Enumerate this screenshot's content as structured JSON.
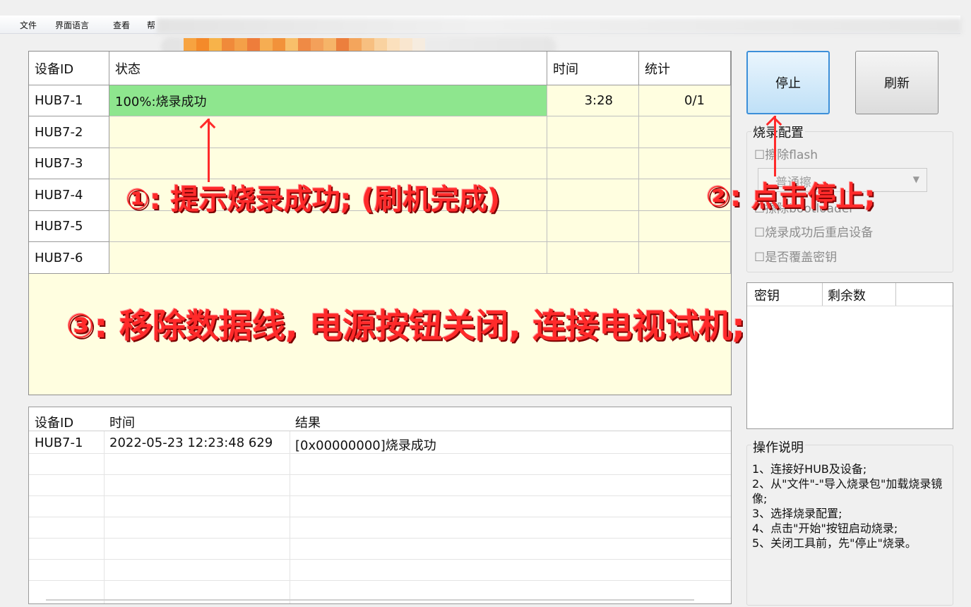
{
  "menu": {
    "file": "文件",
    "language": "界面语言",
    "view": "查看",
    "help_partial": "帮"
  },
  "grid": {
    "headers": {
      "id": "设备ID",
      "status": "状态",
      "time": "时间",
      "stats": "统计"
    },
    "rows": [
      {
        "id": "HUB7-1",
        "status": "100%:烧录成功",
        "time": "3:28",
        "stats": "0/1"
      },
      {
        "id": "HUB7-2",
        "status": "",
        "time": "",
        "stats": ""
      },
      {
        "id": "HUB7-3",
        "status": "",
        "time": "",
        "stats": ""
      },
      {
        "id": "HUB7-4",
        "status": "",
        "time": "",
        "stats": ""
      },
      {
        "id": "HUB7-5",
        "status": "",
        "time": "",
        "stats": ""
      },
      {
        "id": "HUB7-6",
        "status": "",
        "time": "",
        "stats": ""
      }
    ]
  },
  "log": {
    "headers": {
      "id": "设备ID",
      "time": "时间",
      "result": "结果"
    },
    "rows": [
      {
        "id": "HUB7-1",
        "time": "2022-05-23 12:23:48 629",
        "result": "[0x00000000]烧录成功"
      }
    ]
  },
  "buttons": {
    "stop": "停止",
    "refresh": "刷新"
  },
  "burn_config": {
    "title": "烧录配置",
    "erase_flash": "☐擦除flash",
    "combo_value": "普通擦",
    "erase_bootloader": "☐擦除bootloader",
    "reboot_after": "☐烧录成功后重启设备",
    "overwrite_key": "☐是否覆盖密钥"
  },
  "keys": {
    "headers": {
      "key": "密钥",
      "remaining": "剩余数"
    }
  },
  "instructions": {
    "title": "操作说明",
    "lines": [
      "1、连接好HUB及设备;",
      "2、从\"文件\"-\"导入烧录包\"加载烧录镜像;",
      "3、选择烧录配置;",
      "4、点击\"开始\"按钮启动烧录;",
      "5、关闭工具前，先\"停止\"烧录。"
    ]
  },
  "annotations": {
    "step1": "①: 提示烧录成功; (刷机完成)",
    "step2": "②: 点击停止;",
    "step3": "③: 移除数据线, 电源按钮关闭, 连接电视试机;"
  }
}
